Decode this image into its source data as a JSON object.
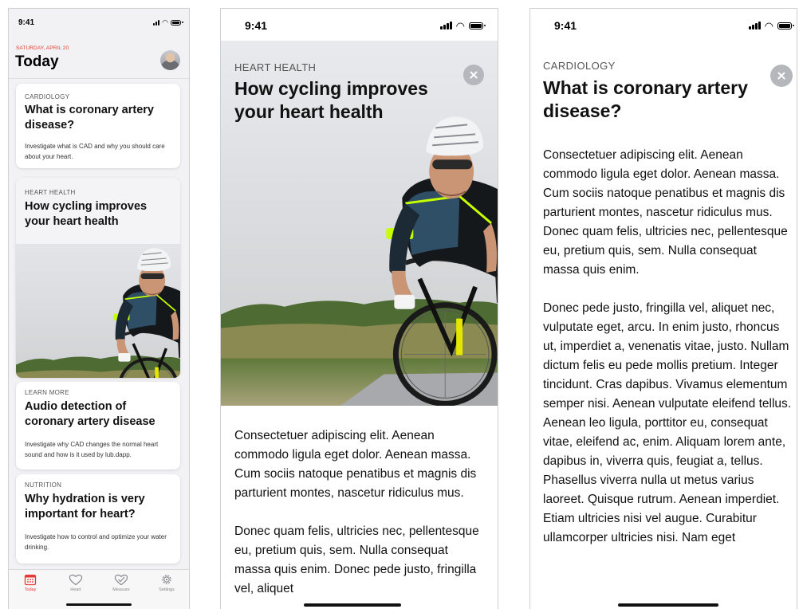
{
  "status_bar": {
    "time": "9:41"
  },
  "screen_today": {
    "date": "SATURDAY, APRIL 20",
    "title": "Today",
    "cards": [
      {
        "category": "CARDIOLOGY",
        "title": "What is coronary artery disease?",
        "description": "Investigate what is CAD and why you should care about your heart."
      },
      {
        "category": "HEART HEALTH",
        "title": "How cycling improves your heart health"
      },
      {
        "category": "LEARN MORE",
        "title": "Audio detection of coronary artery disease",
        "description": "Investigate why CAD changes the normal heart sound and how is it used by lub.dapp."
      },
      {
        "category": "NUTRITION",
        "title": "Why hydration is very important for heart?",
        "description": "Investigate how to control and optimize your water drinking."
      }
    ],
    "tabs": [
      {
        "label": "Today",
        "icon": "calendar-icon",
        "active": true
      },
      {
        "label": "Heart",
        "icon": "heart-icon",
        "active": false
      },
      {
        "label": "Measure",
        "icon": "measure-heart-icon",
        "active": false
      },
      {
        "label": "Settings",
        "icon": "gear-icon",
        "active": false
      }
    ]
  },
  "screen_cycling": {
    "category": "HEART HEALTH",
    "title": "How cycling improves your heart health",
    "paragraphs": [
      "Consectetuer adipiscing elit. Aenean commodo ligula eget dolor. Aenean massa. Cum sociis natoque penatibus et magnis dis parturient montes, nascetur ridiculus mus.",
      "Donec quam felis, ultricies nec, pellentesque eu, pretium quis, sem. Nulla consequat massa quis enim. Donec pede justo, fringilla vel, aliquet"
    ]
  },
  "screen_cad": {
    "category": "CARDIOLOGY",
    "title": "What is coronary artery disease?",
    "paragraphs": [
      "Consectetuer adipiscing elit. Aenean commodo ligula eget dolor. Aenean massa. Cum sociis natoque penatibus et magnis dis parturient montes, nascetur ridiculus mus. Donec quam felis, ultricies nec, pellentesque eu, pretium quis, sem. Nulla consequat massa quis enim.",
      "Donec pede justo, fringilla vel, aliquet nec, vulputate eget, arcu. In enim justo, rhoncus ut, imperdiet a, venenatis vitae, justo. Nullam dictum felis eu pede mollis pretium. Integer tincidunt. Cras dapibus. Vivamus elementum semper nisi. Aenean vulputate eleifend tellus. Aenean leo ligula, porttitor eu, consequat vitae, eleifend ac, enim. Aliquam lorem ante, dapibus in, viverra quis, feugiat a, tellus. Phasellus viverra nulla ut metus varius laoreet. Quisque rutrum. Aenean imperdiet. Etiam ultricies nisi vel augue. Curabitur ullamcorper ultricies nisi. Nam eget"
    ]
  },
  "colors": {
    "accent": "#e53935",
    "text": "#111111",
    "secondary_text": "#555555",
    "background": "#f2f2f4",
    "close_button": "#b5b7bc"
  }
}
